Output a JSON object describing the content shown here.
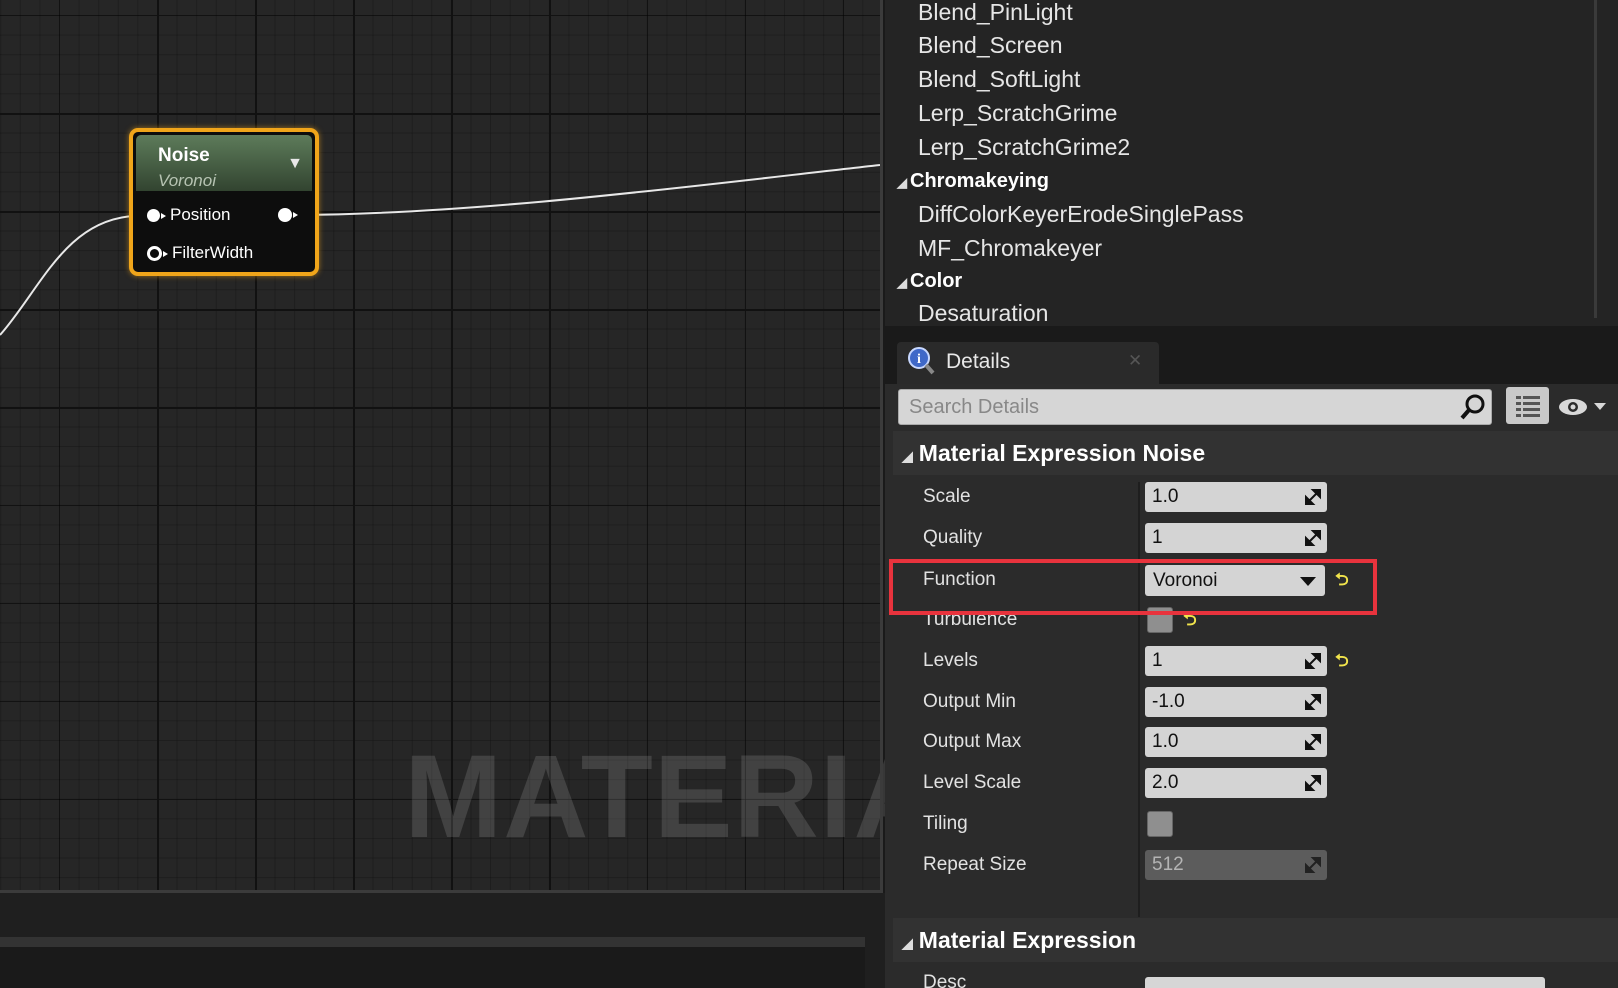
{
  "graph": {
    "watermark": "MATERIAL",
    "node": {
      "title": "Noise",
      "subtitle": "Voronoi",
      "inputs": [
        "Position",
        "FilterWidth"
      ]
    }
  },
  "palette": {
    "items_top": [
      "Blend_PinLight",
      "Blend_Screen",
      "Blend_SoftLight",
      "Lerp_ScratchGrime",
      "Lerp_ScratchGrime2"
    ],
    "category_chromakeying": "Chromakeying",
    "items_chromakeying": [
      "DiffColorKeyerErodeSinglePass",
      "MF_Chromakeyer"
    ],
    "category_color": "Color",
    "items_color": [
      "Desaturation"
    ]
  },
  "details": {
    "tab_label": "Details",
    "search_placeholder": "Search Details",
    "section_noise": "Material Expression Noise",
    "section_expression": "Material Expression",
    "partial_label": "Desc",
    "properties": {
      "scale": {
        "label": "Scale",
        "value": "1.0"
      },
      "quality": {
        "label": "Quality",
        "value": "1"
      },
      "function": {
        "label": "Function",
        "value": "Voronoi"
      },
      "turbulence": {
        "label": "Turbulence",
        "checked": false
      },
      "levels": {
        "label": "Levels",
        "value": "1"
      },
      "output_min": {
        "label": "Output Min",
        "value": "-1.0"
      },
      "output_max": {
        "label": "Output Max",
        "value": "1.0"
      },
      "level_scale": {
        "label": "Level Scale",
        "value": "2.0"
      },
      "tiling": {
        "label": "Tiling",
        "checked": false
      },
      "repeat_size": {
        "label": "Repeat Size",
        "value": "512"
      }
    }
  },
  "colors": {
    "node_selected_border": "#f0a51a",
    "highlight_box": "#e8333d",
    "reset_arrow": "#f1e44c"
  }
}
